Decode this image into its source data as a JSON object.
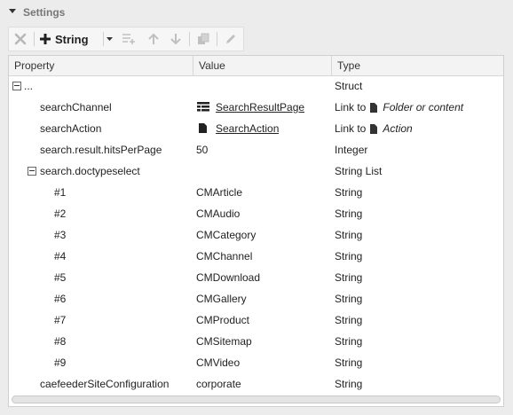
{
  "panel": {
    "title": "Settings"
  },
  "toolbar": {
    "add_label": "String"
  },
  "grid": {
    "columns": {
      "property": "Property",
      "value": "Value",
      "type": "Type"
    },
    "rows": [
      {
        "property": "...",
        "value": "",
        "type": "Struct"
      },
      {
        "property": "searchChannel",
        "value": "SearchResultPage",
        "type_prefix": "Link to",
        "type_target": "Folder or content"
      },
      {
        "property": "searchAction",
        "value": "SearchAction",
        "type_prefix": "Link to",
        "type_target": "Action"
      },
      {
        "property": "search.result.hitsPerPage",
        "value": "50",
        "type": "Integer"
      },
      {
        "property": "search.doctypeselect",
        "value": "",
        "type": "String List"
      },
      {
        "property": "#1",
        "value": "CMArticle",
        "type": "String"
      },
      {
        "property": "#2",
        "value": "CMAudio",
        "type": "String"
      },
      {
        "property": "#3",
        "value": "CMCategory",
        "type": "String"
      },
      {
        "property": "#4",
        "value": "CMChannel",
        "type": "String"
      },
      {
        "property": "#5",
        "value": "CMDownload",
        "type": "String"
      },
      {
        "property": "#6",
        "value": "CMGallery",
        "type": "String"
      },
      {
        "property": "#7",
        "value": "CMProduct",
        "type": "String"
      },
      {
        "property": "#8",
        "value": "CMSitemap",
        "type": "String"
      },
      {
        "property": "#9",
        "value": "CMVideo",
        "type": "String"
      },
      {
        "property": "caefeederSiteConfiguration",
        "value": "corporate",
        "type": "String"
      }
    ]
  }
}
